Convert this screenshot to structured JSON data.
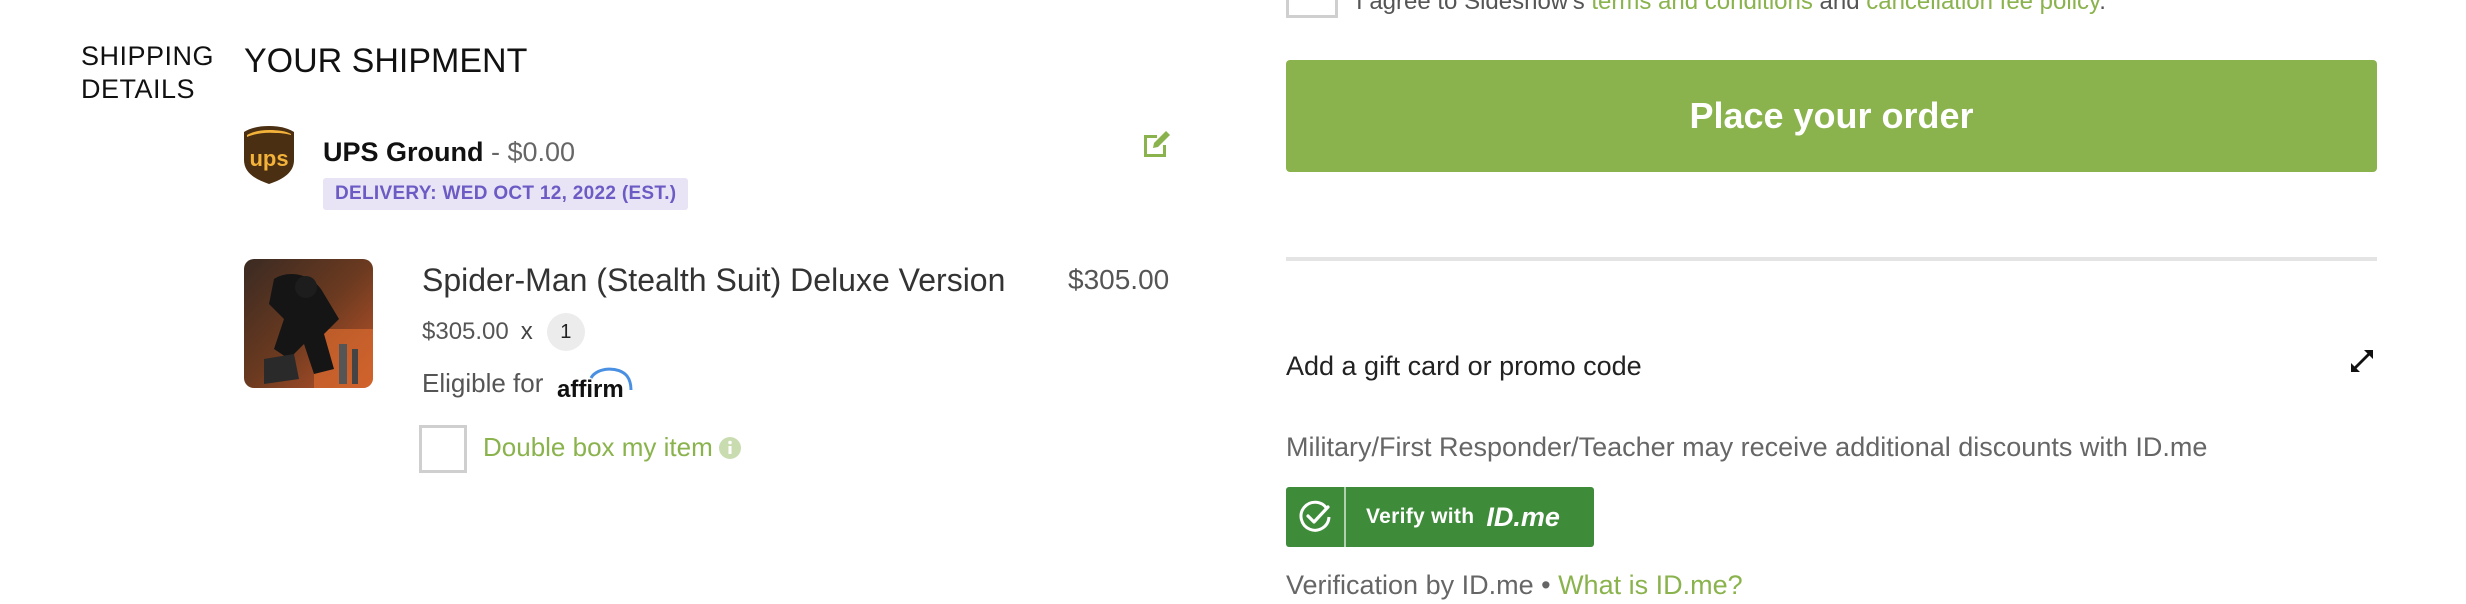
{
  "shipping": {
    "section_label_line1": "SHIPPING",
    "section_label_line2": "DETAILS",
    "title": "YOUR SHIPMENT",
    "carrier_logo_text": "ups",
    "method_name": "UPS Ground",
    "method_price": " - $0.00",
    "delivery_badge": "DELIVERY: WED OCT 12, 2022 (EST.)",
    "edit_icon": "edit-icon"
  },
  "item": {
    "name": "Spider-Man (Stealth Suit) Deluxe Version",
    "total": "$305.00",
    "unit_price": "$305.00",
    "times": "x",
    "quantity": "1",
    "eligible_label": "Eligible for",
    "affirm_logo_text": "affirm",
    "double_box_label": "Double box my item",
    "info_icon": "info-icon"
  },
  "order": {
    "terms_prefix": "I agree to Sideshow's ",
    "terms_link": "terms and conditions",
    "terms_and": " and ",
    "cancellation_link": "cancellation fee policy",
    "terms_suffix": ".",
    "place_order_label": "Place your order"
  },
  "promo": {
    "label": "Add a gift card or promo code",
    "expand_icon": "expand-icon"
  },
  "idme": {
    "discount_text": "Military/First Responder/Teacher may receive additional discounts with ID.me",
    "button_verify": "Verify with",
    "button_brand": "ID.me",
    "verification_text": "Verification by ID.me • ",
    "what_is_link": "What is ID.me?"
  },
  "colors": {
    "accent_green": "#8ab34d",
    "idme_green": "#3e8b3a",
    "badge_bg": "#e8e4f6",
    "badge_text": "#6c5bc4"
  }
}
